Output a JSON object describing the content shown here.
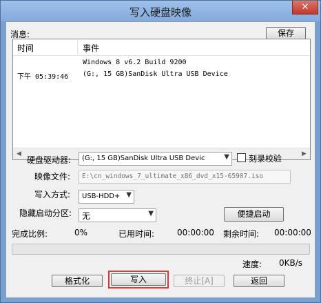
{
  "window": {
    "title": "写入硬盘映像",
    "close_glyph": "✕"
  },
  "messages": {
    "label": "消息:",
    "save_label": "保存",
    "columns": [
      "时间",
      "事件"
    ],
    "rows": [
      {
        "time": "",
        "event": "Windows 8 v6.2 Build 9200"
      },
      {
        "time": "下午 05:39:46",
        "event": "(G:, 15 GB)SanDisk Ultra USB Device"
      }
    ]
  },
  "form": {
    "drive_label": "硬盘驱动器:",
    "drive_value": "(G:, 15 GB)SanDisk Ultra USB Devic",
    "verify_label": "刻录校验",
    "verify_checked": false,
    "image_label": "映像文件:",
    "image_value": "E:\\cn_windows_7_ultimate_x86_dvd_x15-65907.iso",
    "write_mode_label": "写入方式:",
    "write_mode_value": "USB-HDD+",
    "hide_partition_label": "隐藏启动分区:",
    "hide_partition_value": "无",
    "quick_boot_label": "便捷启动"
  },
  "status": {
    "complete_label": "完成比例:",
    "complete_value": "0%",
    "elapsed_label": "已用时间:",
    "elapsed_value": "00:00:00",
    "remaining_label": "剩余时间:",
    "remaining_value": "00:00:00",
    "progress_fraction": 0,
    "speed_label": "速度:",
    "speed_value": "0KB/s"
  },
  "buttons": {
    "format": "格式化",
    "write": "写入",
    "stop": "终止[A]",
    "back": "返回"
  },
  "icons": {
    "scroll_left": "◀",
    "scroll_right": "▶",
    "dropdown": "▼"
  },
  "colors": {
    "highlight_border": "#e03a2e",
    "progress_fill": "#06b025"
  }
}
